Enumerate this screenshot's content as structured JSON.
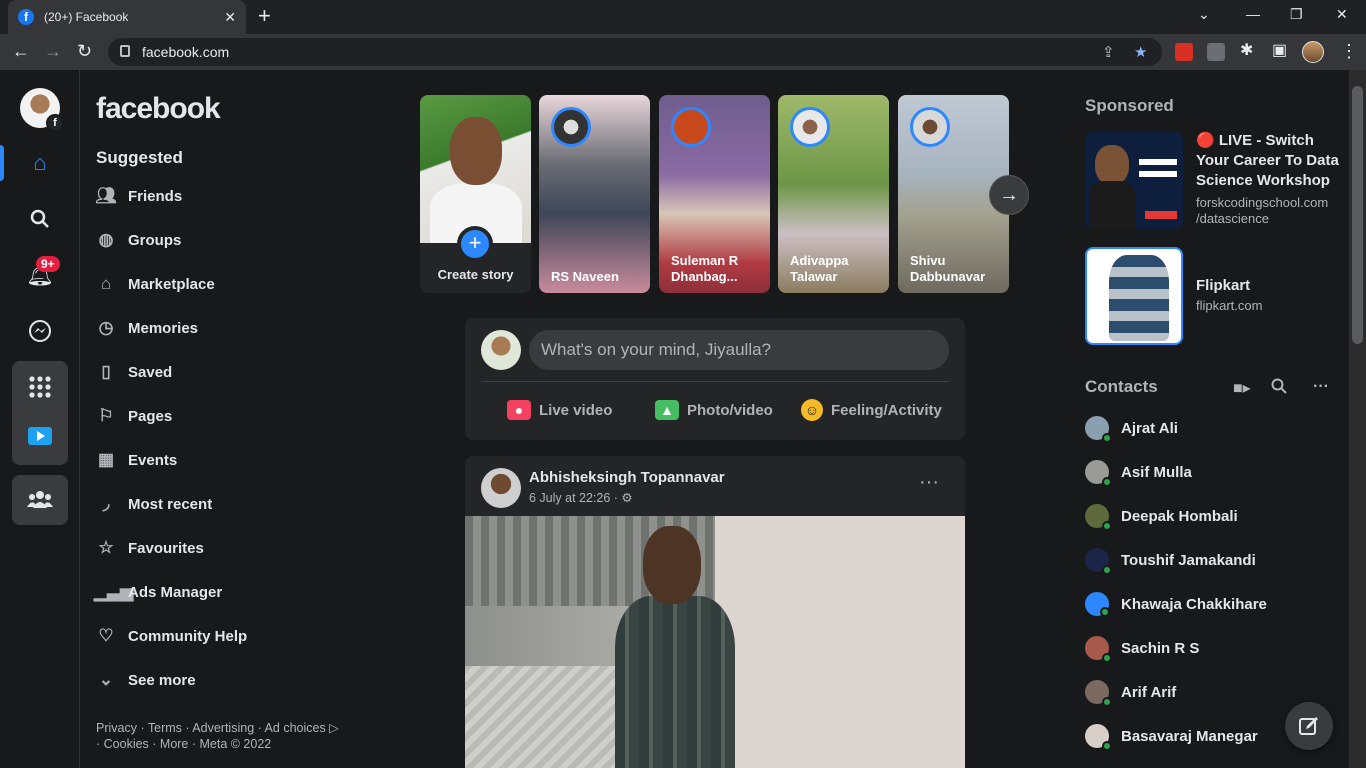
{
  "browser": {
    "tab_title": "(20+) Facebook",
    "tab_favicon": "f",
    "url": "facebook.com",
    "icons": [
      "back-arrow-icon",
      "forward-arrow-icon",
      "reload-icon",
      "lock-icon",
      "share-icon",
      "star-icon",
      "extensions-icon",
      "sidebar-icon",
      "menu-icon"
    ]
  },
  "rail": {
    "profile_badge": "f",
    "notifications_badge": "9+"
  },
  "left": {
    "logo": "facebook",
    "suggested": "Suggested",
    "items": [
      {
        "label": "Friends",
        "icon": "friends-icon"
      },
      {
        "label": "Groups",
        "icon": "groups-icon"
      },
      {
        "label": "Marketplace",
        "icon": "marketplace-icon"
      },
      {
        "label": "Memories",
        "icon": "memories-icon"
      },
      {
        "label": "Saved",
        "icon": "saved-icon"
      },
      {
        "label": "Pages",
        "icon": "pages-icon"
      },
      {
        "label": "Events",
        "icon": "events-icon"
      },
      {
        "label": "Most recent",
        "icon": "most-recent-icon"
      },
      {
        "label": "Favourites",
        "icon": "favourites-icon"
      },
      {
        "label": "Ads Manager",
        "icon": "ads-manager-icon"
      },
      {
        "label": "Community Help",
        "icon": "community-help-icon"
      },
      {
        "label": "See more",
        "icon": "chevron-down-icon"
      }
    ],
    "footer_line1": "Privacy · Terms · Advertising · Ad choices ▷",
    "footer_line2": "· Cookies · More · Meta © 2022"
  },
  "stories": {
    "create_label": "Create story",
    "items": [
      {
        "name": "RS Naveen"
      },
      {
        "name": "Suleman R Dhanbag..."
      },
      {
        "name": "Adivappa Talawar"
      },
      {
        "name": "Shivu Dabbunavar"
      }
    ]
  },
  "composer": {
    "placeholder": "What's on your mind, Jiyaulla?",
    "actions": [
      {
        "label": "Live video",
        "color": "#f3425f"
      },
      {
        "label": "Photo/video",
        "color": "#45bd62"
      },
      {
        "label": "Feeling/Activity",
        "color": "#f7b928"
      }
    ]
  },
  "post": {
    "author": "Abhisheksingh Topannavar",
    "time": "6 July at 22:26 · ⚙",
    "more": "···"
  },
  "right": {
    "sponsored": "Sponsored",
    "ads": [
      {
        "title": "🔴 LIVE - Switch Your Career To Data Science Workshop",
        "url": "forskcodingschool.com /datascience"
      },
      {
        "title": "Flipkart",
        "url": "flipkart.com"
      }
    ],
    "contacts_title": "Contacts",
    "contacts": [
      {
        "name": "Ajrat Ali"
      },
      {
        "name": "Asif Mulla"
      },
      {
        "name": "Deepak Hombali"
      },
      {
        "name": "Toushif Jamakandi"
      },
      {
        "name": "Khawaja Chakkihare"
      },
      {
        "name": "Sachin R S"
      },
      {
        "name": "Arif Arif"
      },
      {
        "name": "Basavaraj Manegar"
      }
    ]
  },
  "colors": {
    "accent": "#2d88ff",
    "background": "#18191a",
    "surface": "#242526",
    "online": "#31a24c",
    "badge": "#e41e3f"
  }
}
